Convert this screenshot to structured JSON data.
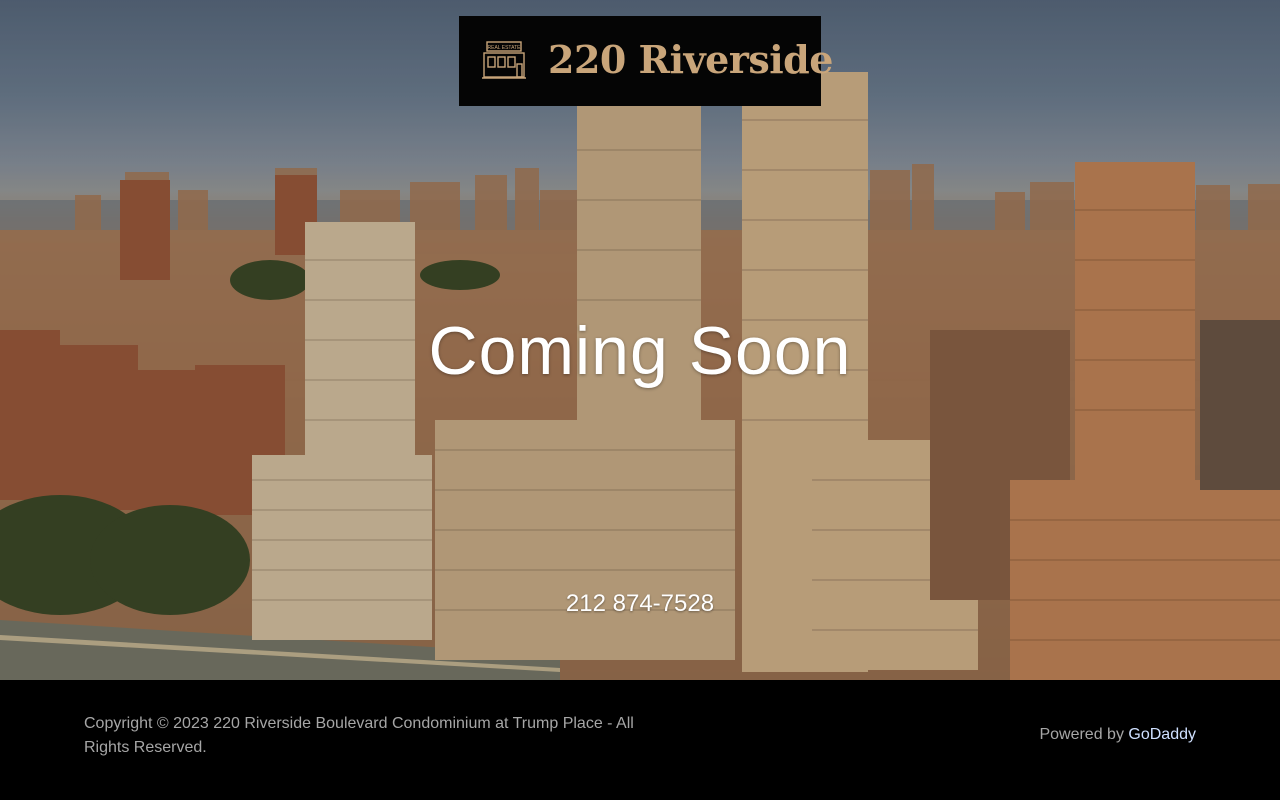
{
  "brand": {
    "name": "220 Riverside",
    "icon": "real-estate-building-icon",
    "icon_sign_text": "REAL ESTATE",
    "accent_color": "#c9a57a"
  },
  "hero": {
    "headline": "Coming Soon",
    "phone": "212 874-7528"
  },
  "footer": {
    "copyright": "Copyright © 2023 220 Riverside Boulevard Condominium at Trump Place - All Rights Reserved.",
    "powered_prefix": "Powered by",
    "powered_link": "GoDaddy",
    "link_color": "#cfe0ff"
  }
}
